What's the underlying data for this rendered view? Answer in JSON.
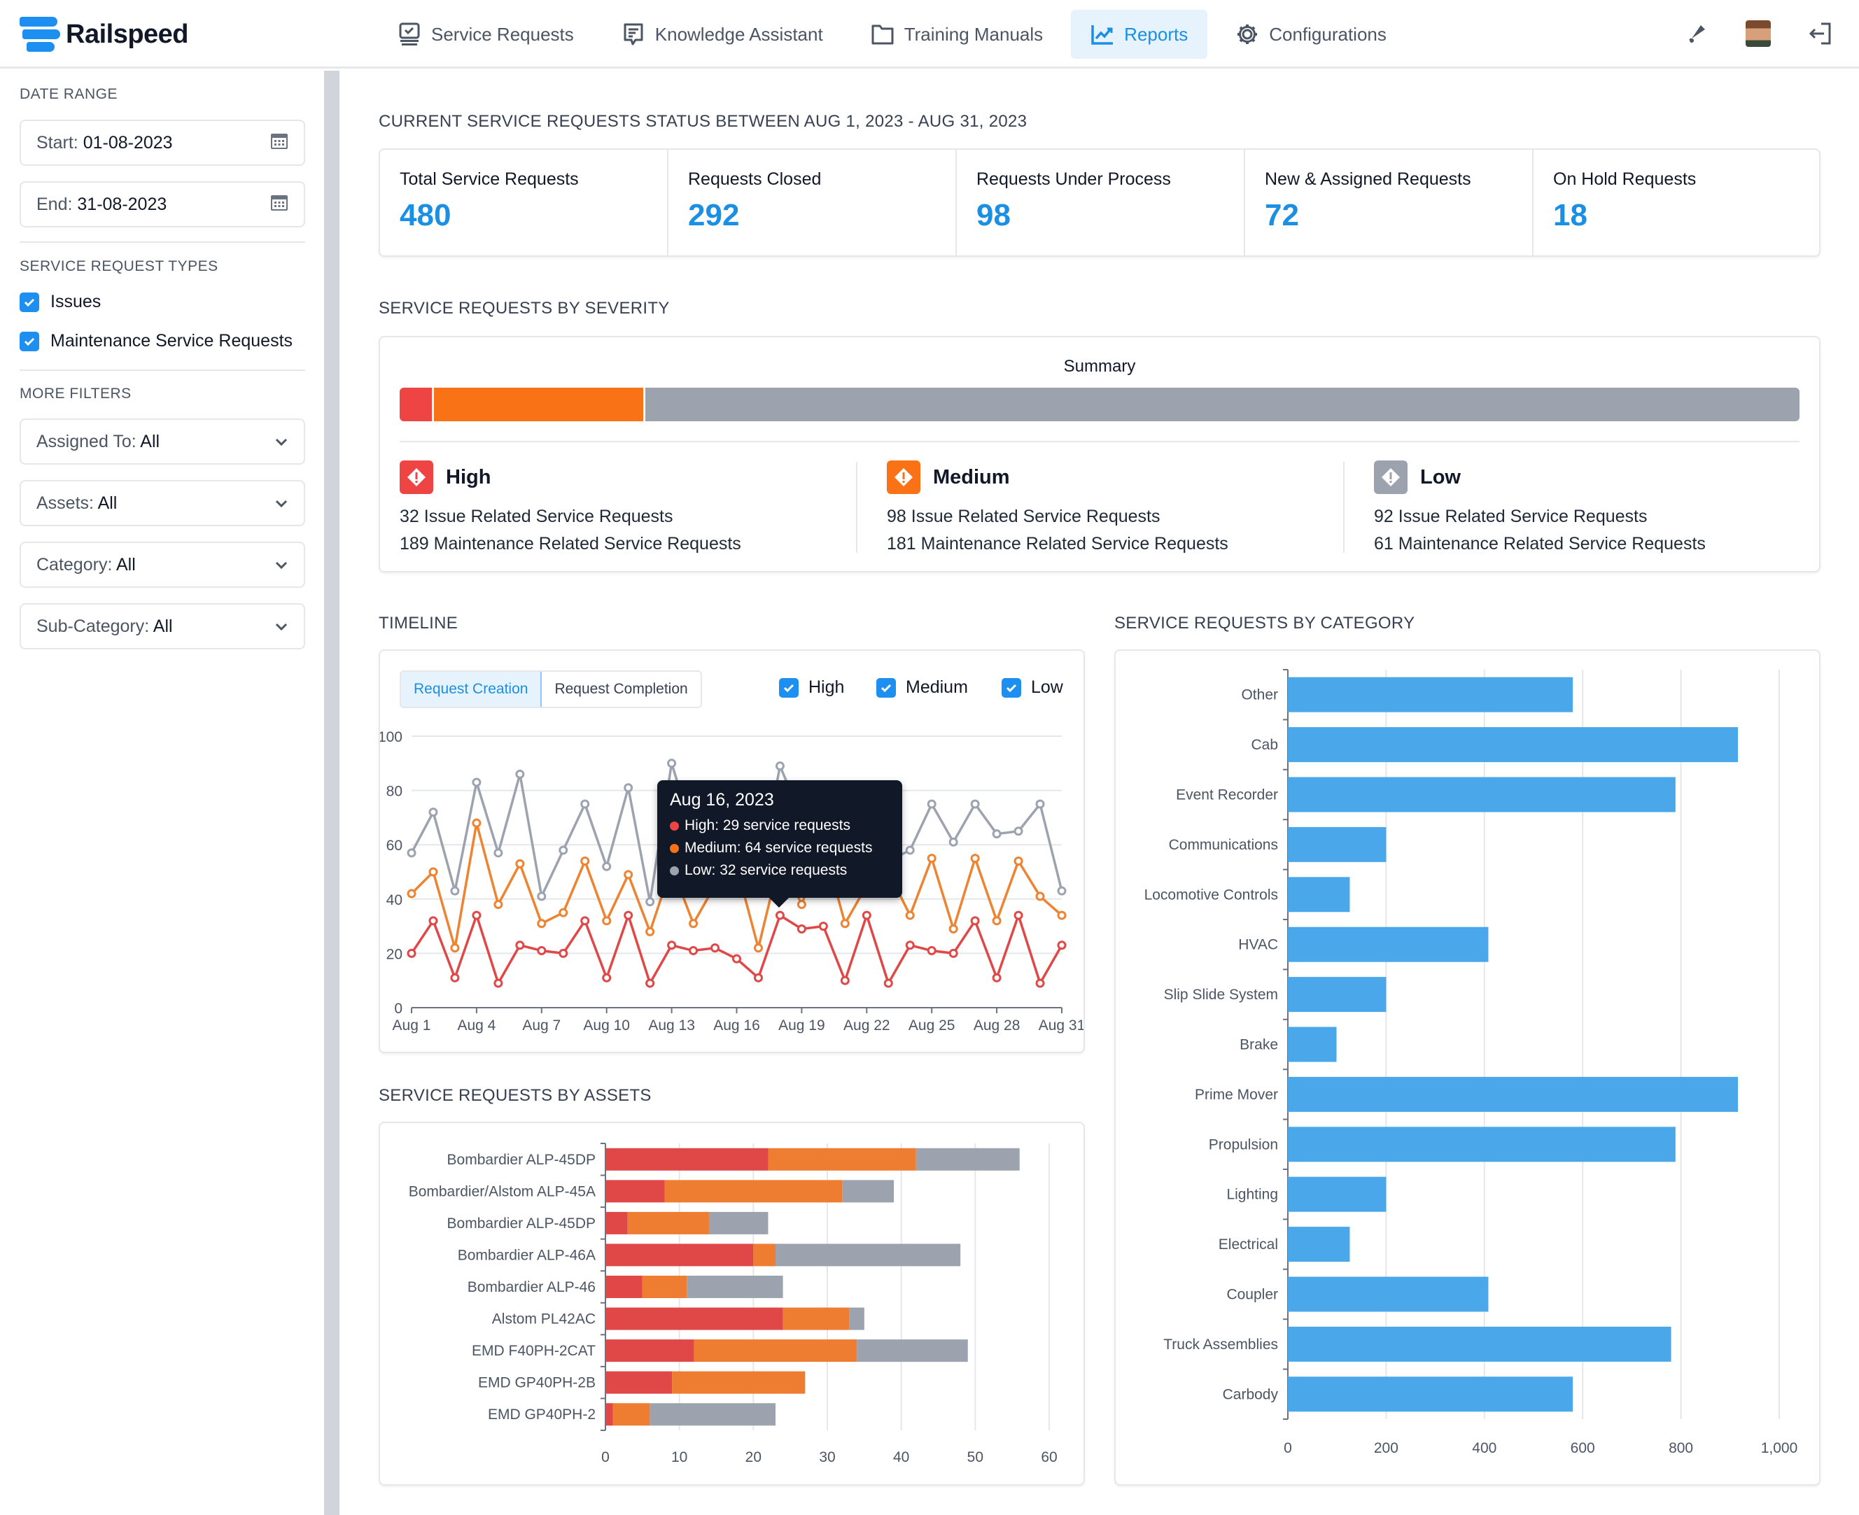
{
  "app": {
    "name": "Railspeed"
  },
  "nav": {
    "items": [
      {
        "label": "Service Requests",
        "icon": "monitor-check-icon",
        "active": false
      },
      {
        "label": "Knowledge Assistant",
        "icon": "chat-document-icon",
        "active": false
      },
      {
        "label": "Training Manuals",
        "icon": "folder-icon",
        "active": false
      },
      {
        "label": "Reports",
        "icon": "chart-line-icon",
        "active": true
      },
      {
        "label": "Configurations",
        "icon": "gear-icon",
        "active": false
      }
    ],
    "right_icons": [
      "notification-bell-icon",
      "user-avatar",
      "logout-icon"
    ]
  },
  "sidebar": {
    "date_range_label": "DATE RANGE",
    "start_prefix": "Start:",
    "start_value": "01-08-2023",
    "end_prefix": "End:",
    "end_value": "31-08-2023",
    "types_label": "SERVICE REQUEST TYPES",
    "types": [
      {
        "label": "Issues",
        "checked": true
      },
      {
        "label": "Maintenance Service Requests",
        "checked": true
      }
    ],
    "more_filters_label": "MORE FILTERS",
    "filters": [
      {
        "prefix": "Assigned To:",
        "value": "All"
      },
      {
        "prefix": "Assets:",
        "value": "All"
      },
      {
        "prefix": "Category:",
        "value": "All"
      },
      {
        "prefix": "Sub-Category:",
        "value": "All"
      }
    ]
  },
  "status": {
    "title": "CURRENT SERVICE REQUESTS STATUS BETWEEN AUG 1, 2023 - AUG 31, 2023",
    "cards": [
      {
        "label": "Total Service Requests",
        "value": "480"
      },
      {
        "label": "Requests Closed",
        "value": "292"
      },
      {
        "label": "Requests Under Process",
        "value": "98"
      },
      {
        "label": "New & Assigned Requests",
        "value": "72"
      },
      {
        "label": "On Hold Requests",
        "value": "18"
      }
    ]
  },
  "severity": {
    "title": "SERVICE REQUESTS BY SEVERITY",
    "summary_label": "Summary",
    "summary_shares": [
      {
        "name": "High",
        "percent": 2.3,
        "color": "#ef4444"
      },
      {
        "name": "Medium",
        "percent": 15.0,
        "color": "#f97316"
      },
      {
        "name": "Low",
        "percent": 82.7,
        "color": "#9ca3af"
      }
    ],
    "levels": [
      {
        "name": "High",
        "color": "#ef4444",
        "issue_line": "32 Issue Related Service Requests",
        "maint_line": "189 Maintenance Related Service Requests"
      },
      {
        "name": "Medium",
        "color": "#f97316",
        "issue_line": "98 Issue Related Service Requests",
        "maint_line": "181 Maintenance Related Service Requests"
      },
      {
        "name": "Low",
        "color": "#9ca3af",
        "issue_line": "92 Issue Related Service Requests",
        "maint_line": "61 Maintenance Related Service Requests"
      }
    ]
  },
  "timeline": {
    "title": "TIMELINE",
    "tabs": [
      {
        "label": "Request Creation",
        "active": true
      },
      {
        "label": "Request Completion",
        "active": false
      }
    ],
    "legend": [
      {
        "label": "High",
        "checked": true
      },
      {
        "label": "Medium",
        "checked": true
      },
      {
        "label": "Low",
        "checked": true
      }
    ],
    "tooltip": {
      "title": "Aug 16, 2023",
      "rows": [
        {
          "text": "High: 29 service requests",
          "color": "#ef4444"
        },
        {
          "text": "Medium: 64 service requests",
          "color": "#f97316"
        },
        {
          "text": "Low: 32 service requests",
          "color": "#9ca3af"
        }
      ]
    }
  },
  "assets": {
    "title": "SERVICE REQUESTS BY ASSETS"
  },
  "category": {
    "title": "SERVICE REQUESTS BY CATEGORY"
  },
  "chart_data": [
    {
      "id": "timeline",
      "type": "line",
      "title": "TIMELINE",
      "x": [
        "Aug 1",
        "Aug 2",
        "Aug 3",
        "Aug 4",
        "Aug 5",
        "Aug 6",
        "Aug 7",
        "Aug 8",
        "Aug 9",
        "Aug 10",
        "Aug 11",
        "Aug 12",
        "Aug 13",
        "Aug 14",
        "Aug 15",
        "Aug 16",
        "Aug 17",
        "Aug 18",
        "Aug 19",
        "Aug 20",
        "Aug 21",
        "Aug 22",
        "Aug 23",
        "Aug 24",
        "Aug 25",
        "Aug 26",
        "Aug 27",
        "Aug 28",
        "Aug 29",
        "Aug 30",
        "Aug 31"
      ],
      "x_ticks": [
        "Aug 1",
        "Aug 4",
        "Aug 7",
        "Aug 10",
        "Aug 13",
        "Aug 16",
        "Aug 19",
        "Aug 22",
        "Aug 25",
        "Aug 28",
        "Aug 31"
      ],
      "ylim": [
        0,
        100
      ],
      "y_ticks": [
        0,
        20,
        40,
        60,
        80,
        100
      ],
      "grid": true,
      "series": [
        {
          "name": "High",
          "color": "#e04848",
          "values": [
            20,
            32,
            11,
            34,
            9,
            23,
            21,
            20,
            32,
            11,
            34,
            9,
            23,
            21,
            22,
            18,
            11,
            34,
            29,
            30,
            10,
            34,
            9,
            23,
            21,
            20,
            32,
            11,
            34,
            9,
            23
          ]
        },
        {
          "name": "Medium",
          "color": "#ee8331",
          "values": [
            42,
            50,
            22,
            68,
            38,
            53,
            31,
            35,
            54,
            32,
            49,
            28,
            52,
            31,
            45,
            52,
            22,
            55,
            38,
            60,
            31,
            45,
            50,
            34,
            55,
            29,
            55,
            32,
            54,
            41,
            34
          ]
        },
        {
          "name": "Low",
          "color": "#9ca3af",
          "values": [
            57,
            72,
            43,
            83,
            57,
            86,
            41,
            58,
            75,
            52,
            81,
            39,
            90,
            64,
            70,
            62,
            47,
            89,
            70,
            72,
            58,
            61,
            54,
            58,
            75,
            61,
            75,
            64,
            65,
            75,
            43
          ]
        }
      ]
    },
    {
      "id": "assets",
      "type": "bar",
      "orientation": "horizontal",
      "stacked": true,
      "title": "SERVICE REQUESTS BY ASSETS",
      "categories": [
        "Bombardier ALP-45DP",
        "Bombardier/Alstom ALP-45A",
        "Bombardier ALP-45DP",
        "Bombardier ALP-46A",
        "Bombardier ALP-46",
        "Alstom PL42AC",
        "EMD F40PH-2CAT",
        "EMD GP40PH-2B",
        "EMD GP40PH-2"
      ],
      "xlim": [
        0,
        60
      ],
      "x_ticks": [
        0,
        10,
        20,
        30,
        40,
        50,
        60
      ],
      "grid": true,
      "series": [
        {
          "name": "High",
          "color": "#e04848",
          "values": [
            22,
            8,
            3,
            20,
            5,
            24,
            12,
            9,
            1
          ]
        },
        {
          "name": "Medium",
          "color": "#ee7c31",
          "values": [
            20,
            24,
            11,
            3,
            6,
            9,
            22,
            18,
            5
          ]
        },
        {
          "name": "Low",
          "color": "#9ca3af",
          "values": [
            14,
            7,
            8,
            25,
            13,
            2,
            15,
            0,
            17
          ]
        }
      ]
    },
    {
      "id": "category",
      "type": "bar",
      "orientation": "horizontal",
      "title": "SERVICE REQUESTS BY CATEGORY",
      "categories": [
        "Other",
        "Cab",
        "Event Recorder",
        "Communications",
        "Locomotive Controls",
        "HVAC",
        "Slip Slide  System",
        "Brake",
        "Prime Mover",
        "Propulsion",
        "Lighting",
        "Electrical",
        "Coupler",
        "Truck Assemblies",
        "Carbody"
      ],
      "values": [
        580,
        916,
        789,
        200,
        126,
        408,
        200,
        99,
        916,
        789,
        200,
        126,
        408,
        780,
        580
      ],
      "color": "#4aa8ea",
      "xlim": [
        0,
        1000
      ],
      "x_ticks": [
        "0",
        "200",
        "400",
        "600",
        "800",
        "1,000"
      ],
      "grid": true
    }
  ]
}
